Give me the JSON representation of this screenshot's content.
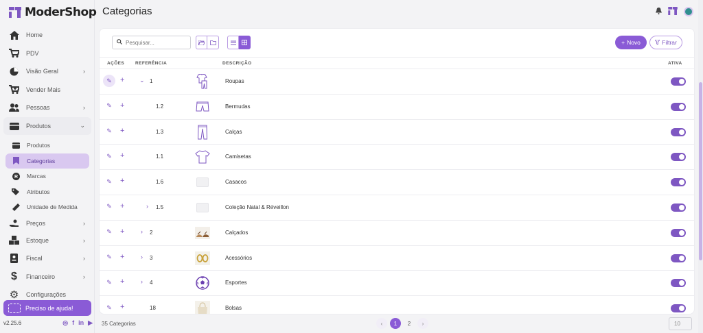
{
  "app": {
    "name": "ModerShop",
    "version": "v2.25.6"
  },
  "header": {
    "title": "Categorias"
  },
  "sidebar": {
    "items": [
      {
        "label": "Home",
        "icon": "home-icon"
      },
      {
        "label": "PDV",
        "icon": "cart-icon"
      },
      {
        "label": "Visão Geral",
        "icon": "pie-chart-icon"
      },
      {
        "label": "Vender Mais",
        "icon": "cart-plus-icon"
      },
      {
        "label": "Pessoas",
        "icon": "people-icon"
      },
      {
        "label": "Produtos",
        "icon": "box-icon"
      }
    ],
    "sub_items": [
      {
        "label": "Produtos",
        "icon": "box-icon"
      },
      {
        "label": "Categorias",
        "icon": "bookmark-icon"
      },
      {
        "label": "Marcas",
        "icon": "registered-icon"
      },
      {
        "label": "Atributos",
        "icon": "tags-icon"
      },
      {
        "label": "Unidade de Medida",
        "icon": "ruler-icon"
      }
    ],
    "lower_items": [
      {
        "label": "Preços",
        "icon": "hand-coin-icon"
      },
      {
        "label": "Estoque",
        "icon": "boxes-icon"
      },
      {
        "label": "Fiscal",
        "icon": "id-card-icon"
      },
      {
        "label": "Financeiro",
        "icon": "dollar-icon"
      },
      {
        "label": "Configurações",
        "icon": "gear-icon"
      }
    ],
    "help_label": "Preciso de ajuda!"
  },
  "toolbar": {
    "search_placeholder": "Pesquisar...",
    "new_label": "Novo",
    "filter_label": "Filtrar"
  },
  "table": {
    "headers": {
      "actions": "AÇÕES",
      "reference": "REFERÊNCIA",
      "description": "DESCRIÇÃO",
      "active": "ATIVA"
    },
    "rows": [
      {
        "ref": "1",
        "desc": "Roupas",
        "expand": "open",
        "thumb": "shirt-pants-icon",
        "active": true
      },
      {
        "ref": "1.2",
        "desc": "Bermudas",
        "expand": "none",
        "thumb": "shorts-icon",
        "active": true
      },
      {
        "ref": "1.3",
        "desc": "Calças",
        "expand": "none",
        "thumb": "pants-icon",
        "active": true
      },
      {
        "ref": "1.1",
        "desc": "Camisetas",
        "expand": "none",
        "thumb": "tshirt-icon",
        "active": true
      },
      {
        "ref": "1.6",
        "desc": "Casacos",
        "expand": "none",
        "thumb": "placeholder-image",
        "active": true
      },
      {
        "ref": "1.5",
        "desc": "Coleção Natal & Réveillon",
        "expand": "closed",
        "thumb": "placeholder-image",
        "active": true
      },
      {
        "ref": "2",
        "desc": "Calçados",
        "expand": "closed",
        "thumb": "sandals-photo",
        "active": true
      },
      {
        "ref": "3",
        "desc": "Acessórios",
        "expand": "closed",
        "thumb": "earrings-photo",
        "active": true
      },
      {
        "ref": "4",
        "desc": "Esportes",
        "expand": "closed",
        "thumb": "soccer-ball-icon",
        "active": true
      },
      {
        "ref": "18",
        "desc": "Bolsas",
        "expand": "none",
        "thumb": "bag-photo",
        "active": true
      }
    ]
  },
  "footer": {
    "count_label": "35 Categorias",
    "pages": [
      "1",
      "2"
    ],
    "current_page": "1",
    "page_size": "10"
  },
  "colors": {
    "accent": "#8a5bd6",
    "accent_light": "#d9c8f0"
  }
}
